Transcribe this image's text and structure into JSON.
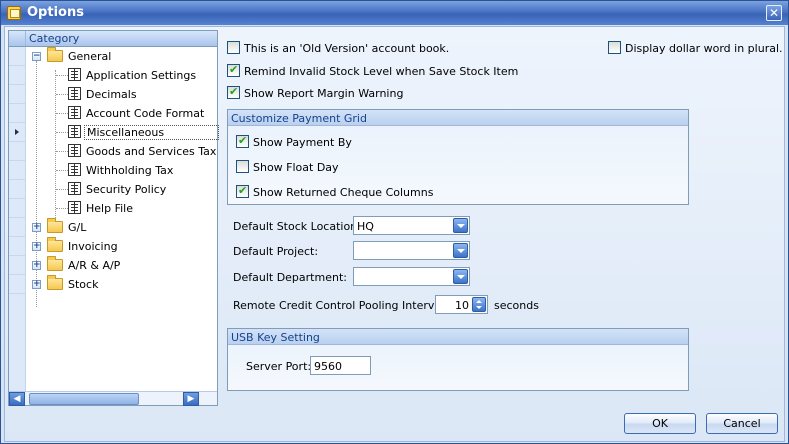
{
  "window": {
    "title": "Options"
  },
  "category": {
    "header": "Category",
    "items": [
      {
        "label": "General",
        "level": 0,
        "expander": "−"
      },
      {
        "label": "Application Settings",
        "level": 1
      },
      {
        "label": "Decimals",
        "level": 1
      },
      {
        "label": "Account Code Format",
        "level": 1
      },
      {
        "label": "Miscellaneous",
        "level": 1,
        "selected": true
      },
      {
        "label": "Goods and Services Tax",
        "level": 1
      },
      {
        "label": "Withholding Tax",
        "level": 1
      },
      {
        "label": "Security Policy",
        "level": 1
      },
      {
        "label": "Help File",
        "level": 1
      },
      {
        "label": "G/L",
        "level": 0,
        "expander": "+"
      },
      {
        "label": "Invoicing",
        "level": 0,
        "expander": "+"
      },
      {
        "label": "A/R & A/P",
        "level": 0,
        "expander": "+"
      },
      {
        "label": "Stock",
        "level": 0,
        "expander": "+"
      }
    ]
  },
  "options": {
    "old_version": {
      "label": "This is an 'Old Version' account book.",
      "checked": false
    },
    "dollar_plural": {
      "label": "Display dollar word in plural.",
      "checked": false
    },
    "remind_invalid_stock": {
      "label": "Remind Invalid Stock Level when Save Stock Item",
      "checked": true
    },
    "report_margin": {
      "label": "Show Report Margin Warning",
      "checked": true
    }
  },
  "payment_grid": {
    "title": "Customize Payment Grid",
    "show_payment_by": {
      "label": "Show Payment By",
      "checked": true
    },
    "show_float_day": {
      "label": "Show Float Day",
      "checked": false
    },
    "show_returned_cheque": {
      "label": "Show Returned Cheque Columns",
      "checked": true
    }
  },
  "defaults": {
    "stock_location_label": "Default Stock Location:",
    "stock_location_value": "HQ",
    "project_label": "Default Project:",
    "project_value": "",
    "department_label": "Default Department:",
    "department_value": ""
  },
  "credit_control": {
    "label": "Remote Credit Control Pooling Interval:",
    "value": "10",
    "unit": "seconds"
  },
  "usb": {
    "title": "USB Key Setting",
    "server_port_label": "Server Port:",
    "server_port_value": "9560"
  },
  "buttons": {
    "ok": "OK",
    "cancel": "Cancel"
  },
  "colors": {
    "title_bar": "#3a63b6",
    "accent_text": "#15428b",
    "check_mark": "#21a121"
  }
}
